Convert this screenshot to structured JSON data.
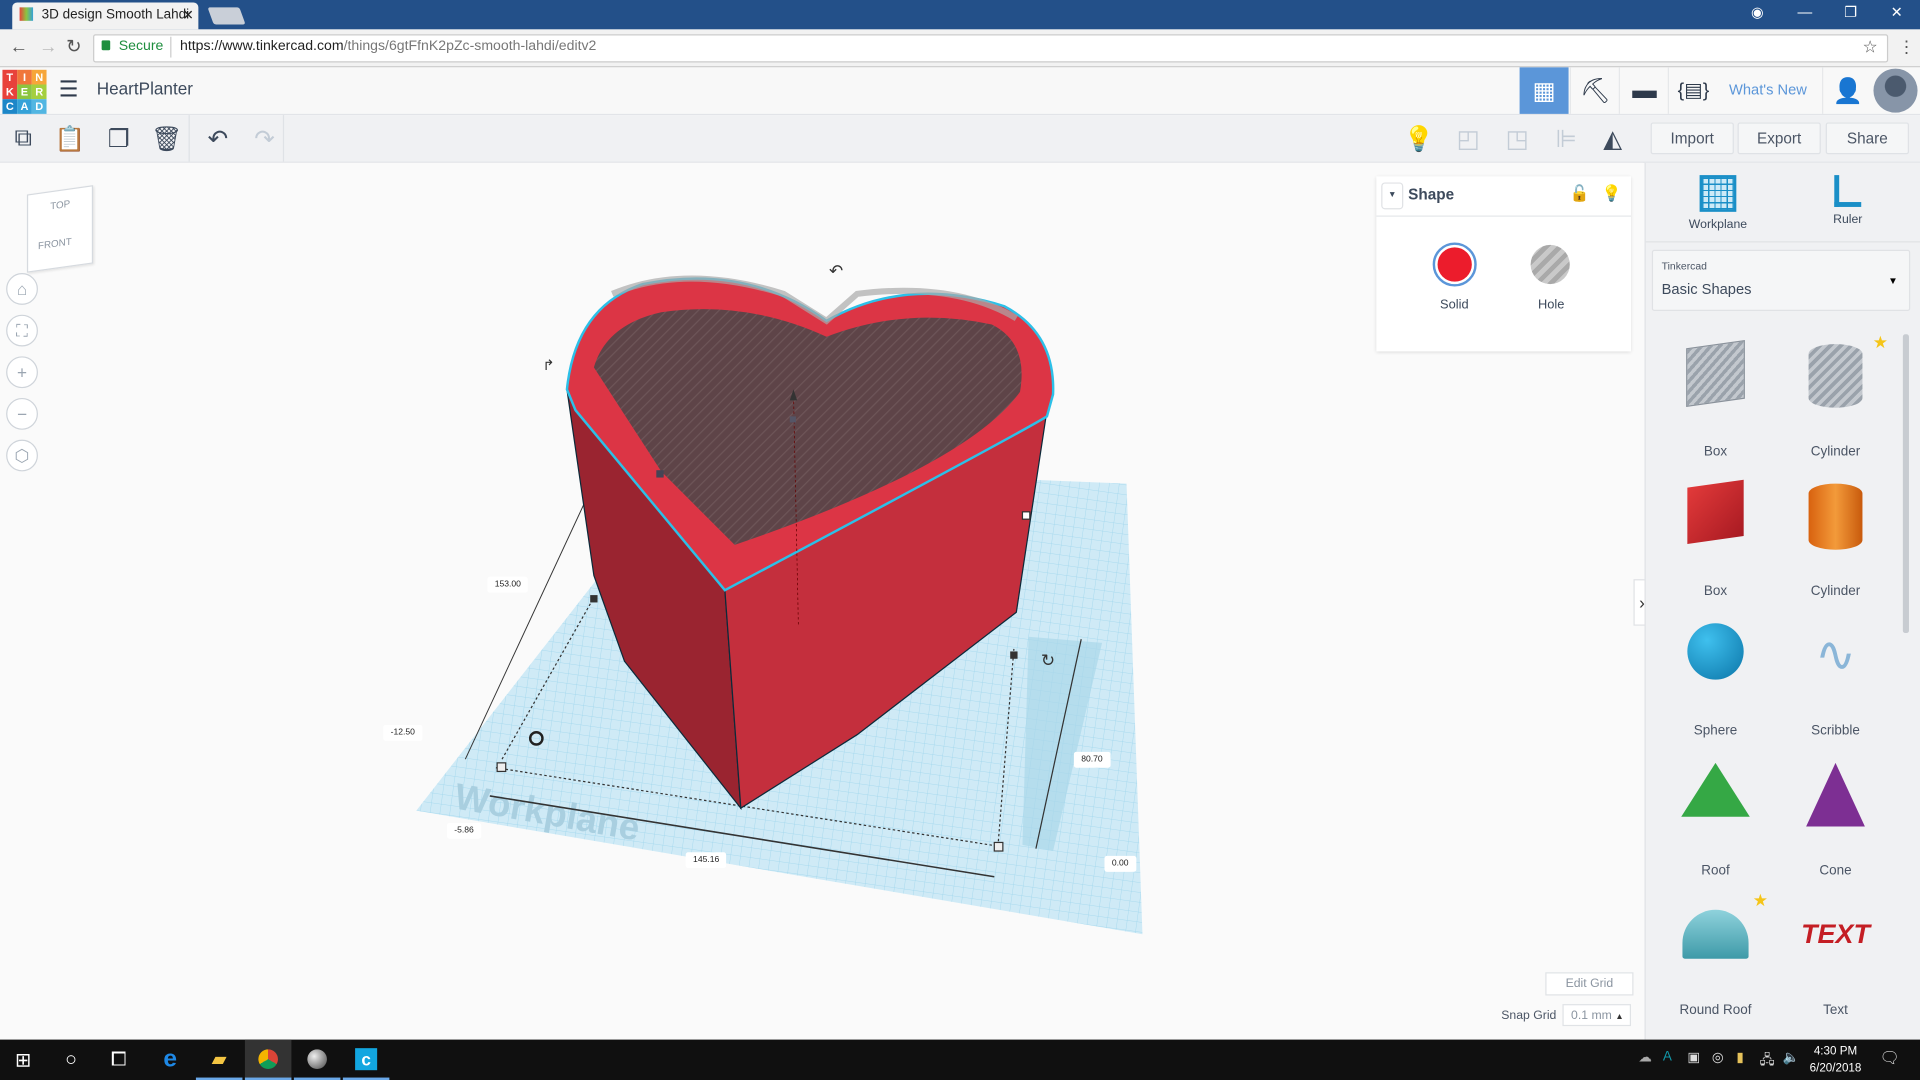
{
  "browser": {
    "tab_title": "3D design Smooth Lahdi",
    "close": "✕",
    "secure_label": "Secure",
    "url_host": "https://www.tinkercad.com",
    "url_path": "/things/6gtFfnK2pZc-smooth-lahdi/editv2"
  },
  "app": {
    "logo_letters": [
      "T",
      "I",
      "N",
      "K",
      "E",
      "R",
      "C",
      "A",
      "D"
    ],
    "logo_colors": [
      "#e8423b",
      "#f0763a",
      "#f6a63a",
      "#e8423b",
      "#8cc540",
      "#a4cf3e",
      "#1d87c8",
      "#35a2d8",
      "#52b6e2"
    ],
    "project_title": "HeartPlanter",
    "whats_new": "What's New"
  },
  "toolbar": {
    "import": "Import",
    "export": "Export",
    "share": "Share"
  },
  "viewcube": {
    "top": "TOP",
    "front": "FRONT"
  },
  "shape_panel": {
    "title": "Shape",
    "solid": "Solid",
    "hole": "Hole",
    "solid_color": "#ec1c2c"
  },
  "dimensions": {
    "length": "153.00",
    "x_offset": "-12.50",
    "y_offset": "-5.86",
    "width": "145.16",
    "height": "80.70",
    "elevation": "0.00"
  },
  "workplane_watermark": "Workplane",
  "sidebar": {
    "workplane": "Workplane",
    "ruler": "Ruler",
    "library_source": "Tinkercad",
    "library_name": "Basic Shapes",
    "shapes": [
      {
        "label": "Box",
        "kind": "box-hole"
      },
      {
        "label": "Cylinder",
        "kind": "cylinder-hole",
        "favorite": true
      },
      {
        "label": "Box",
        "kind": "box"
      },
      {
        "label": "Cylinder",
        "kind": "cylinder"
      },
      {
        "label": "Sphere",
        "kind": "sphere"
      },
      {
        "label": "Scribble",
        "kind": "scribble"
      },
      {
        "label": "Roof",
        "kind": "roof"
      },
      {
        "label": "Cone",
        "kind": "cone"
      },
      {
        "label": "Round Roof",
        "kind": "round-roof",
        "favorite": true
      },
      {
        "label": "Text",
        "kind": "text"
      }
    ]
  },
  "grid": {
    "edit_grid": "Edit Grid",
    "snap_grid_label": "Snap Grid",
    "snap_grid_value": "0.1 mm"
  },
  "taskbar": {
    "time": "4:30 PM",
    "date": "6/20/2018"
  }
}
